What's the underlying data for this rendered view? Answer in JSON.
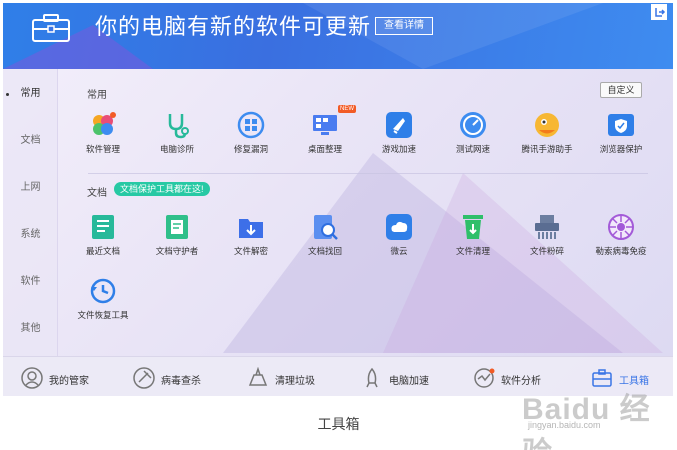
{
  "header": {
    "title": "你的电脑有新的软件可更新",
    "details_button": "查看详情",
    "icons": [
      "toolbox-icon",
      "exit-icon"
    ]
  },
  "sidebar": {
    "items": [
      {
        "label": "常用",
        "active": true
      },
      {
        "label": "文档"
      },
      {
        "label": "上网"
      },
      {
        "label": "系统"
      },
      {
        "label": "软件"
      },
      {
        "label": "其他"
      }
    ]
  },
  "sections": {
    "common_label": "常用",
    "docs_label": "文档",
    "customize_button": "自定义",
    "docs_tip": "文档保护工具都在这!"
  },
  "common_tools": [
    {
      "label": "软件管理",
      "icon": "software-manager-icon"
    },
    {
      "label": "电脑诊所",
      "icon": "stethoscope-icon"
    },
    {
      "label": "修复漏洞",
      "icon": "windows-repair-icon"
    },
    {
      "label": "桌面整理",
      "icon": "desktop-organize-icon",
      "badge": "NEW"
    },
    {
      "label": "游戏加速",
      "icon": "game-boost-icon"
    },
    {
      "label": "测试网速",
      "icon": "speedometer-icon"
    },
    {
      "label": "腾讯手游助手",
      "icon": "mobile-game-icon"
    },
    {
      "label": "浏览器保护",
      "icon": "browser-shield-icon"
    }
  ],
  "doc_tools": [
    {
      "label": "最近文档",
      "icon": "recent-docs-icon"
    },
    {
      "label": "文档守护者",
      "icon": "doc-guardian-icon"
    },
    {
      "label": "文件解密",
      "icon": "file-decrypt-icon"
    },
    {
      "label": "文档找回",
      "icon": "doc-recover-icon"
    },
    {
      "label": "微云",
      "icon": "weiyun-icon"
    },
    {
      "label": "文件清理",
      "icon": "file-clean-icon"
    },
    {
      "label": "文件粉碎",
      "icon": "file-shredder-icon"
    },
    {
      "label": "勒索病毒免疫",
      "icon": "ransomware-immunity-icon"
    },
    {
      "label": "文件恢复工具",
      "icon": "file-restore-icon"
    }
  ],
  "bottom_nav": [
    {
      "label": "我的管家",
      "icon": "my-manager-icon"
    },
    {
      "label": "病毒查杀",
      "icon": "virus-scan-icon"
    },
    {
      "label": "清理垃圾",
      "icon": "cleanup-icon"
    },
    {
      "label": "电脑加速",
      "icon": "rocket-icon"
    },
    {
      "label": "软件分析",
      "icon": "software-analysis-icon"
    },
    {
      "label": "工具箱",
      "icon": "toolbox-nav-icon",
      "active": true
    }
  ],
  "caption": "工具箱",
  "watermark": {
    "logo": "Baidu 经验",
    "url": "jingyan.baidu.com"
  },
  "colors": {
    "header": "#3a75e6",
    "accent_green": "#27c9a4",
    "badge_red": "#f25b26"
  }
}
